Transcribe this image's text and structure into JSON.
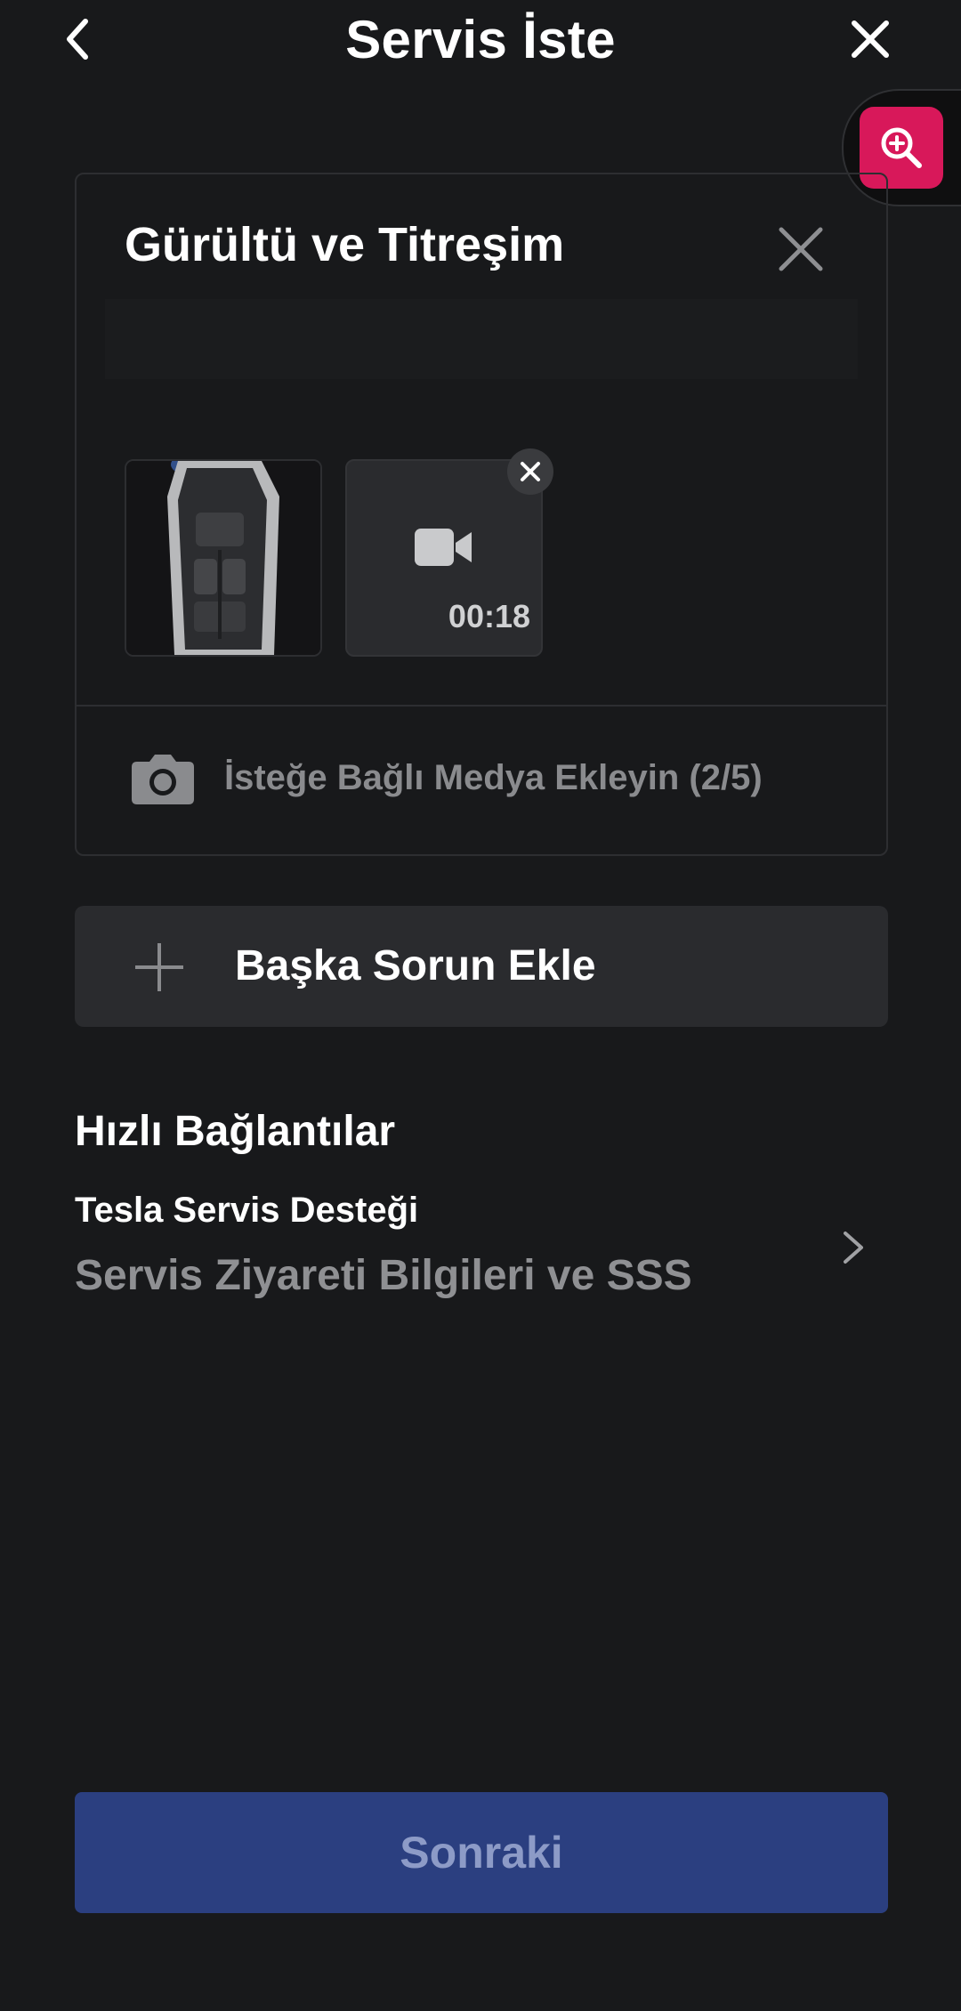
{
  "header": {
    "title": "Servis İste",
    "back_icon": "chevron-left-icon",
    "close_icon": "close-icon"
  },
  "zoom_tool": {
    "icon": "zoom-in-icon",
    "color": "#d8185a"
  },
  "issue": {
    "title": "Gürültü ve Titreşim",
    "remove_icon": "close-icon",
    "description": "",
    "media": [
      {
        "type": "image",
        "alt": "car-interior-photo"
      },
      {
        "type": "video",
        "duration": "00:18"
      }
    ],
    "add_media_label": "İsteğe Bağlı Medya Ekleyin (2/5)"
  },
  "add_issue": {
    "label": "Başka Sorun Ekle"
  },
  "quick_links": {
    "heading": "Hızlı Bağlantılar",
    "items": [
      {
        "title": "Tesla Servis Desteği",
        "subtitle": "Servis Ziyareti Bilgileri ve SSS"
      }
    ]
  },
  "footer": {
    "next_label": "Sonraki",
    "next_color": "#2b3f80"
  }
}
